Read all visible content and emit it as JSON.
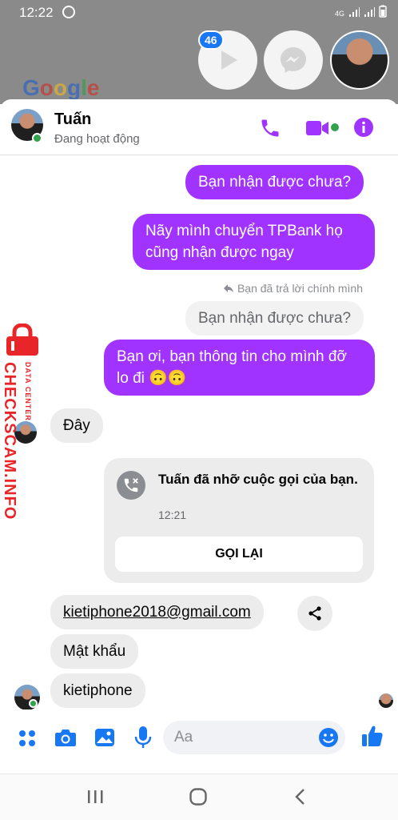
{
  "status_bar": {
    "time": "12:22",
    "network": "4G"
  },
  "home": {
    "google_logo": "Google"
  },
  "chat_heads": {
    "badge_count": "46"
  },
  "header": {
    "name": "Tuấn",
    "status": "Đang hoạt động"
  },
  "messages": [
    {
      "id": "m1",
      "from": "me",
      "text": "Bạn nhận được chưa?"
    },
    {
      "id": "m2",
      "from": "me",
      "text": "Nãy mình chuyển TPBank họ cũng nhận được ngay"
    },
    {
      "id": "m3",
      "from": "them",
      "text": "Bạn nhận được chưa?",
      "reply_note": "Bạn đã trả lời chính mình"
    },
    {
      "id": "m4",
      "from": "me",
      "text": "Bạn ơi, bạn thông tin cho mình đỡ lo đi 🙃🙃"
    },
    {
      "id": "m5",
      "from": "them",
      "text": "Đây"
    },
    {
      "id": "m6",
      "from": "them",
      "text": "kietiphone2018@gmail.com"
    },
    {
      "id": "m7",
      "from": "them",
      "text": "Mật khẩu"
    },
    {
      "id": "m8",
      "from": "them",
      "text": "kietiphone"
    }
  ],
  "missed_call": {
    "text": "Tuấn đã nhỡ cuộc gọi của bạn.",
    "time": "12:21",
    "button": "GỌI LẠI"
  },
  "composer": {
    "placeholder": "Aa"
  },
  "watermark": {
    "main": "CHECKSCAM.INFO",
    "sub": "DATA CENTER"
  },
  "colors": {
    "accent": "#a033ff",
    "blue": "#1877f2",
    "online": "#31a24c"
  }
}
